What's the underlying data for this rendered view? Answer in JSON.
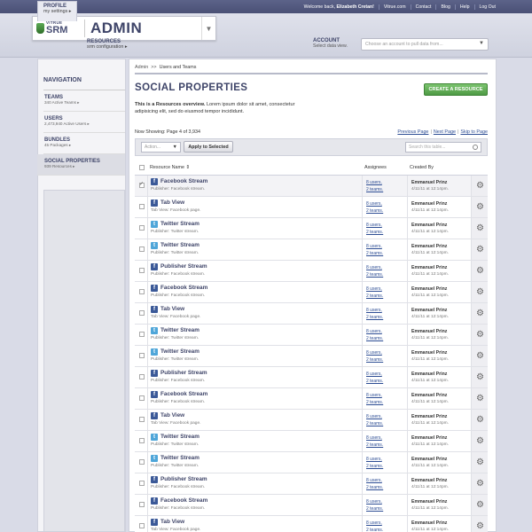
{
  "topnav": {
    "welcome_prefix": "Welcome back,",
    "user_name": "Elizabeth Cretan!",
    "links": [
      "Vitrue.com",
      "Contact",
      "Blog",
      "Help",
      "Log Out"
    ]
  },
  "brand": {
    "logo_small": "VITRUE",
    "logo_big": "SRM",
    "section_title": "ADMIN"
  },
  "header_nav": {
    "profile": {
      "label": "PROFILE",
      "sub": "my settings ▸"
    },
    "resources": {
      "label": "RESOURCES",
      "sub": "srm configuration ▸"
    }
  },
  "account": {
    "label": "ACCOUNT",
    "sub": "Select data view.",
    "placeholder": "Choose an account to pull data from..."
  },
  "sidebar": {
    "heading": "NAVIGATION",
    "items": [
      {
        "label": "TEAMS",
        "sub": "340 Active Teams ▸"
      },
      {
        "label": "USERS",
        "sub": "2,473,940 Active Users ▸"
      },
      {
        "label": "BUNDLES",
        "sub": "45 Packages ▸"
      },
      {
        "label": "SOCIAL PROPERTIES",
        "sub": "939 Resources ▸"
      }
    ]
  },
  "breadcrumb": {
    "root": "Admin",
    "sep": ">>",
    "current": "Users and Teams"
  },
  "page": {
    "title": "SOCIAL PROPERTIES",
    "create_label": "CREATE A RESOURCE",
    "overview_bold": "This is a Resources overview.",
    "overview_rest": " Lorem ipsum dolor sit amet, consectetur adipisicing elit, sed do eiusmod tempor incididunt.",
    "showing": "Now Showing: Page 4 of 3,934",
    "pager": {
      "prev": "Previous Page",
      "next": "Next Page",
      "skip": "Skip to Page"
    }
  },
  "toolbar": {
    "action_placeholder": "Action...",
    "apply_label": "Apply to Selected",
    "search_placeholder": "Search this table..."
  },
  "table": {
    "headers": {
      "name": "Resource Name ⇕",
      "assignees": "Assignees",
      "created_by": "Created By"
    },
    "rows": [
      {
        "icon": "facebook",
        "name": "Facebook Stream",
        "sub": "Publisher: Facebook stream.",
        "users": "8 users,",
        "teams": "2 teams.",
        "by": "Emmanuel Prinz",
        "date": "4/11/11 at 12:14pm.",
        "checked": true
      },
      {
        "icon": "facebook",
        "name": "Tab View",
        "sub": "Tab View: Facebook page.",
        "users": "8 users,",
        "teams": "2 teams.",
        "by": "Emmanuel Prinz",
        "date": "4/11/11 at 12:14pm.",
        "checked": false
      },
      {
        "icon": "twitter",
        "name": "Twitter Stream",
        "sub": "Publisher: Twitter stream.",
        "users": "8 users,",
        "teams": "2 teams.",
        "by": "Emmanuel Prinz",
        "date": "4/11/11 at 12:14pm.",
        "checked": false
      },
      {
        "icon": "twitter",
        "name": "Twitter Stream",
        "sub": "Publisher: Twitter stream.",
        "users": "8 users,",
        "teams": "2 teams.",
        "by": "Emmanuel Prinz",
        "date": "4/11/11 at 12:14pm.",
        "checked": false
      },
      {
        "icon": "facebook",
        "name": "Publisher Stream",
        "sub": "Publisher: Facebook stream.",
        "users": "8 users,",
        "teams": "2 teams.",
        "by": "Emmanuel Prinz",
        "date": "4/11/11 at 12:14pm.",
        "checked": false
      },
      {
        "icon": "facebook",
        "name": "Facebook Stream",
        "sub": "Publisher: Facebook stream.",
        "users": "8 users,",
        "teams": "2 teams.",
        "by": "Emmanuel Prinz",
        "date": "4/11/11 at 12:14pm.",
        "checked": false
      },
      {
        "icon": "facebook",
        "name": "Tab View",
        "sub": "Tab View: Facebook page.",
        "users": "8 users,",
        "teams": "2 teams.",
        "by": "Emmanuel Prinz",
        "date": "4/11/11 at 12:14pm.",
        "checked": false
      },
      {
        "icon": "twitter",
        "name": "Twitter Stream",
        "sub": "Publisher: Twitter stream.",
        "users": "8 users,",
        "teams": "2 teams.",
        "by": "Emmanuel Prinz",
        "date": "4/11/11 at 12:14pm.",
        "checked": false
      },
      {
        "icon": "twitter",
        "name": "Twitter Stream",
        "sub": "Publisher: Twitter stream.",
        "users": "8 users,",
        "teams": "2 teams.",
        "by": "Emmanuel Prinz",
        "date": "4/11/11 at 12:14pm.",
        "checked": false
      },
      {
        "icon": "facebook",
        "name": "Publisher Stream",
        "sub": "Publisher: Facebook stream.",
        "users": "8 users,",
        "teams": "2 teams.",
        "by": "Emmanuel Prinz",
        "date": "4/11/11 at 12:14pm.",
        "checked": false
      },
      {
        "icon": "facebook",
        "name": "Facebook Stream",
        "sub": "Publisher: Facebook stream.",
        "users": "8 users,",
        "teams": "2 teams.",
        "by": "Emmanuel Prinz",
        "date": "4/11/11 at 12:14pm.",
        "checked": false
      },
      {
        "icon": "facebook",
        "name": "Tab View",
        "sub": "Tab View: Facebook page.",
        "users": "8 users,",
        "teams": "2 teams.",
        "by": "Emmanuel Prinz",
        "date": "4/11/11 at 12:14pm.",
        "checked": false
      },
      {
        "icon": "twitter",
        "name": "Twitter Stream",
        "sub": "Publisher: Twitter stream.",
        "users": "8 users,",
        "teams": "2 teams.",
        "by": "Emmanuel Prinz",
        "date": "4/11/11 at 12:14pm.",
        "checked": false
      },
      {
        "icon": "twitter",
        "name": "Twitter Stream",
        "sub": "Publisher: Twitter stream.",
        "users": "8 users,",
        "teams": "2 teams.",
        "by": "Emmanuel Prinz",
        "date": "4/11/11 at 12:14pm.",
        "checked": false
      },
      {
        "icon": "facebook",
        "name": "Publisher Stream",
        "sub": "Publisher: Facebook stream.",
        "users": "8 users,",
        "teams": "2 teams.",
        "by": "Emmanuel Prinz",
        "date": "4/11/11 at 12:14pm.",
        "checked": false
      },
      {
        "icon": "facebook",
        "name": "Facebook Stream",
        "sub": "Publisher: Facebook stream.",
        "users": "8 users,",
        "teams": "2 teams.",
        "by": "Emmanuel Prinz",
        "date": "4/11/11 at 12:14pm.",
        "checked": false
      },
      {
        "icon": "facebook",
        "name": "Tab View",
        "sub": "Tab View: Facebook page.",
        "users": "8 users,",
        "teams": "2 teams.",
        "by": "Emmanuel Prinz",
        "date": "4/11/11 at 12:14pm.",
        "checked": false
      }
    ]
  },
  "colors": {
    "accent": "#3e4468",
    "topbar": "#4a5075",
    "create_button": "#5aa64f",
    "link": "#2d4d94"
  }
}
